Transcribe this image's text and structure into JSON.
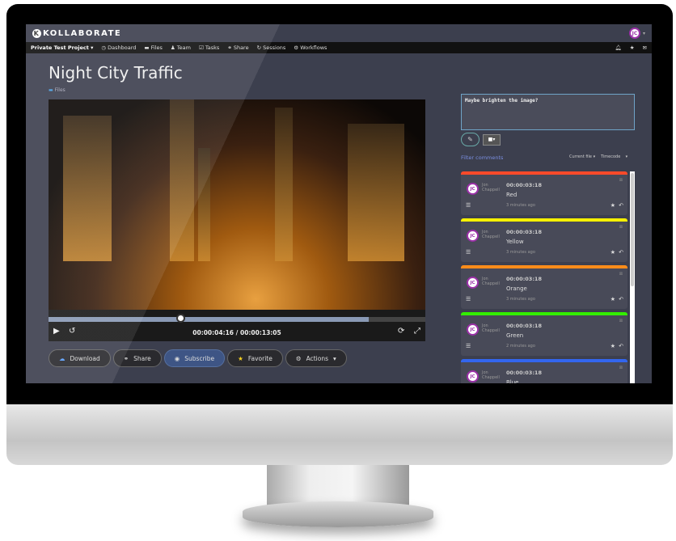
{
  "app": {
    "logo": "KOLLABORATE",
    "user_initials": "JC"
  },
  "nav": {
    "project": "Private Test Project",
    "items": [
      {
        "icon": "clock-icon",
        "label": "Dashboard"
      },
      {
        "icon": "folder-icon",
        "label": "Files"
      },
      {
        "icon": "person-icon",
        "label": "Team"
      },
      {
        "icon": "checkbox-icon",
        "label": "Tasks"
      },
      {
        "icon": "link-icon",
        "label": "Share"
      },
      {
        "icon": "refresh-icon",
        "label": "Sessions"
      },
      {
        "icon": "gear-icon",
        "label": "Workflows"
      }
    ]
  },
  "page": {
    "title": "Night City Traffic",
    "breadcrumb": "Files"
  },
  "player": {
    "time": "00:00:04:16 / 00:00:13:05",
    "played_fraction": 0.35,
    "buffered_fraction": 0.85
  },
  "actions": [
    {
      "icon": "cloud-download-icon",
      "label": "Download"
    },
    {
      "icon": "link-icon",
      "label": "Share"
    },
    {
      "icon": "eye-icon",
      "label": "Subscribe"
    },
    {
      "icon": "star-icon",
      "label": "Favorite"
    },
    {
      "icon": "gear-icon",
      "label": "Actions"
    }
  ],
  "comment_input": {
    "value": "Maybe brighten the image?"
  },
  "filter": {
    "label": "Filter comments",
    "scope": "Current file",
    "sort": "Timecode"
  },
  "comments": [
    {
      "color": "#ff4a2a",
      "first": "Jon",
      "last": "Chappell",
      "initials": "JC",
      "timecode": "00:00:03:18",
      "text": "Red",
      "ago": "3 minutes ago"
    },
    {
      "color": "#f5f000",
      "first": "Jon",
      "last": "Chappell",
      "initials": "JC",
      "timecode": "00:00:03:18",
      "text": "Yellow",
      "ago": "3 minutes ago"
    },
    {
      "color": "#ff8c1a",
      "first": "Jon",
      "last": "Chappell",
      "initials": "JC",
      "timecode": "00:00:03:18",
      "text": "Orange",
      "ago": "3 minutes ago"
    },
    {
      "color": "#33ee00",
      "first": "Jon",
      "last": "Chappell",
      "initials": "JC",
      "timecode": "00:00:03:18",
      "text": "Green",
      "ago": "2 minutes ago"
    },
    {
      "color": "#3366ee",
      "first": "Jon",
      "last": "Chappell",
      "initials": "JC",
      "timecode": "00:00:03:18",
      "text": "Blue",
      "ago": ""
    }
  ]
}
